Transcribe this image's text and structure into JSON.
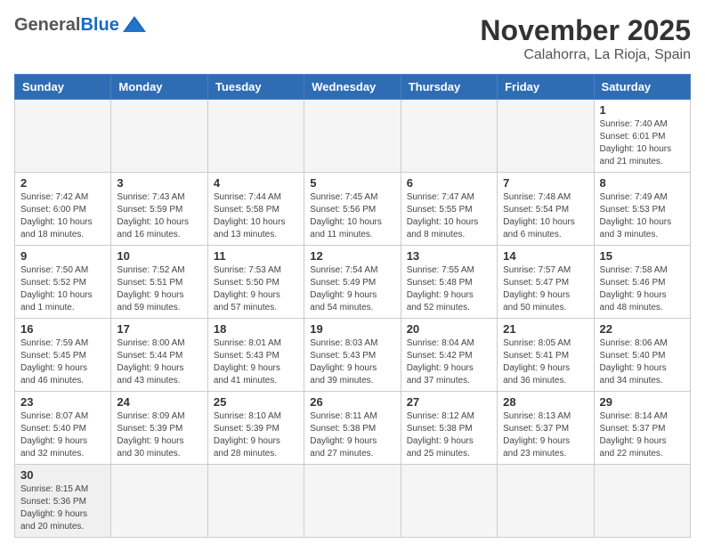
{
  "header": {
    "logo_general": "General",
    "logo_blue": "Blue",
    "month_title": "November 2025",
    "location": "Calahorra, La Rioja, Spain"
  },
  "days_of_week": [
    "Sunday",
    "Monday",
    "Tuesday",
    "Wednesday",
    "Thursday",
    "Friday",
    "Saturday"
  ],
  "weeks": [
    [
      {
        "day": "",
        "info": ""
      },
      {
        "day": "",
        "info": ""
      },
      {
        "day": "",
        "info": ""
      },
      {
        "day": "",
        "info": ""
      },
      {
        "day": "",
        "info": ""
      },
      {
        "day": "",
        "info": ""
      },
      {
        "day": "1",
        "info": "Sunrise: 7:40 AM\nSunset: 6:01 PM\nDaylight: 10 hours\nand 21 minutes."
      }
    ],
    [
      {
        "day": "2",
        "info": "Sunrise: 7:42 AM\nSunset: 6:00 PM\nDaylight: 10 hours\nand 18 minutes."
      },
      {
        "day": "3",
        "info": "Sunrise: 7:43 AM\nSunset: 5:59 PM\nDaylight: 10 hours\nand 16 minutes."
      },
      {
        "day": "4",
        "info": "Sunrise: 7:44 AM\nSunset: 5:58 PM\nDaylight: 10 hours\nand 13 minutes."
      },
      {
        "day": "5",
        "info": "Sunrise: 7:45 AM\nSunset: 5:56 PM\nDaylight: 10 hours\nand 11 minutes."
      },
      {
        "day": "6",
        "info": "Sunrise: 7:47 AM\nSunset: 5:55 PM\nDaylight: 10 hours\nand 8 minutes."
      },
      {
        "day": "7",
        "info": "Sunrise: 7:48 AM\nSunset: 5:54 PM\nDaylight: 10 hours\nand 6 minutes."
      },
      {
        "day": "8",
        "info": "Sunrise: 7:49 AM\nSunset: 5:53 PM\nDaylight: 10 hours\nand 3 minutes."
      }
    ],
    [
      {
        "day": "9",
        "info": "Sunrise: 7:50 AM\nSunset: 5:52 PM\nDaylight: 10 hours\nand 1 minute."
      },
      {
        "day": "10",
        "info": "Sunrise: 7:52 AM\nSunset: 5:51 PM\nDaylight: 9 hours\nand 59 minutes."
      },
      {
        "day": "11",
        "info": "Sunrise: 7:53 AM\nSunset: 5:50 PM\nDaylight: 9 hours\nand 57 minutes."
      },
      {
        "day": "12",
        "info": "Sunrise: 7:54 AM\nSunset: 5:49 PM\nDaylight: 9 hours\nand 54 minutes."
      },
      {
        "day": "13",
        "info": "Sunrise: 7:55 AM\nSunset: 5:48 PM\nDaylight: 9 hours\nand 52 minutes."
      },
      {
        "day": "14",
        "info": "Sunrise: 7:57 AM\nSunset: 5:47 PM\nDaylight: 9 hours\nand 50 minutes."
      },
      {
        "day": "15",
        "info": "Sunrise: 7:58 AM\nSunset: 5:46 PM\nDaylight: 9 hours\nand 48 minutes."
      }
    ],
    [
      {
        "day": "16",
        "info": "Sunrise: 7:59 AM\nSunset: 5:45 PM\nDaylight: 9 hours\nand 46 minutes."
      },
      {
        "day": "17",
        "info": "Sunrise: 8:00 AM\nSunset: 5:44 PM\nDaylight: 9 hours\nand 43 minutes."
      },
      {
        "day": "18",
        "info": "Sunrise: 8:01 AM\nSunset: 5:43 PM\nDaylight: 9 hours\nand 41 minutes."
      },
      {
        "day": "19",
        "info": "Sunrise: 8:03 AM\nSunset: 5:43 PM\nDaylight: 9 hours\nand 39 minutes."
      },
      {
        "day": "20",
        "info": "Sunrise: 8:04 AM\nSunset: 5:42 PM\nDaylight: 9 hours\nand 37 minutes."
      },
      {
        "day": "21",
        "info": "Sunrise: 8:05 AM\nSunset: 5:41 PM\nDaylight: 9 hours\nand 36 minutes."
      },
      {
        "day": "22",
        "info": "Sunrise: 8:06 AM\nSunset: 5:40 PM\nDaylight: 9 hours\nand 34 minutes."
      }
    ],
    [
      {
        "day": "23",
        "info": "Sunrise: 8:07 AM\nSunset: 5:40 PM\nDaylight: 9 hours\nand 32 minutes."
      },
      {
        "day": "24",
        "info": "Sunrise: 8:09 AM\nSunset: 5:39 PM\nDaylight: 9 hours\nand 30 minutes."
      },
      {
        "day": "25",
        "info": "Sunrise: 8:10 AM\nSunset: 5:39 PM\nDaylight: 9 hours\nand 28 minutes."
      },
      {
        "day": "26",
        "info": "Sunrise: 8:11 AM\nSunset: 5:38 PM\nDaylight: 9 hours\nand 27 minutes."
      },
      {
        "day": "27",
        "info": "Sunrise: 8:12 AM\nSunset: 5:38 PM\nDaylight: 9 hours\nand 25 minutes."
      },
      {
        "day": "28",
        "info": "Sunrise: 8:13 AM\nSunset: 5:37 PM\nDaylight: 9 hours\nand 23 minutes."
      },
      {
        "day": "29",
        "info": "Sunrise: 8:14 AM\nSunset: 5:37 PM\nDaylight: 9 hours\nand 22 minutes."
      }
    ],
    [
      {
        "day": "30",
        "info": "Sunrise: 8:15 AM\nSunset: 5:36 PM\nDaylight: 9 hours\nand 20 minutes."
      },
      {
        "day": "",
        "info": ""
      },
      {
        "day": "",
        "info": ""
      },
      {
        "day": "",
        "info": ""
      },
      {
        "day": "",
        "info": ""
      },
      {
        "day": "",
        "info": ""
      },
      {
        "day": "",
        "info": ""
      }
    ]
  ]
}
